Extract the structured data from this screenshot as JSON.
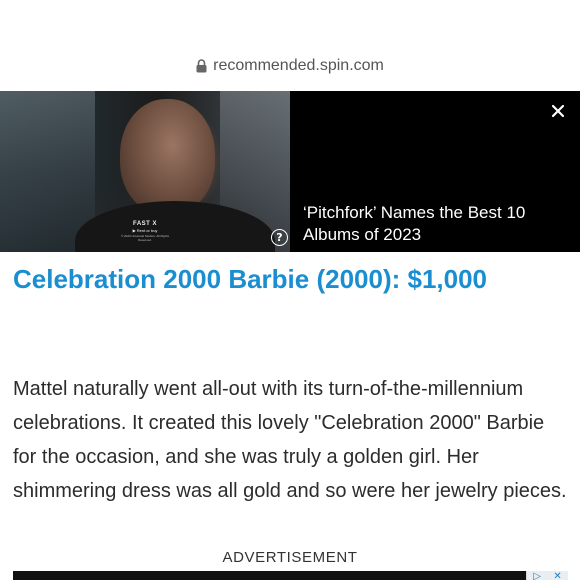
{
  "browser": {
    "url": "recommended.spin.com"
  },
  "video_ad": {
    "title": "‘Pitchfork’ Names the Best 10 Albums of 2023",
    "caption_title": "FAST X",
    "caption_sub": "▶ Rent or buy",
    "caption_fine": "© 2023 Universal Studios. All Rights Reserved.",
    "help_icon": "?",
    "close_icon": "close-icon"
  },
  "article": {
    "heading": "Celebration 2000 Barbie (2000): $1,000",
    "body": "Mattel naturally went all-out with its turn-of-the-millennium celebrations. It created this lovely \"Celebration 2000\" Barbie for the occasion, and she was truly a golden girl. Her shimmering dress was all gold and so were her jewelry pieces."
  },
  "advertisement": {
    "label": "ADVERTISEMENT"
  },
  "colors": {
    "heading": "#1a8ed0",
    "ad_choices": "#2a7fb8"
  }
}
